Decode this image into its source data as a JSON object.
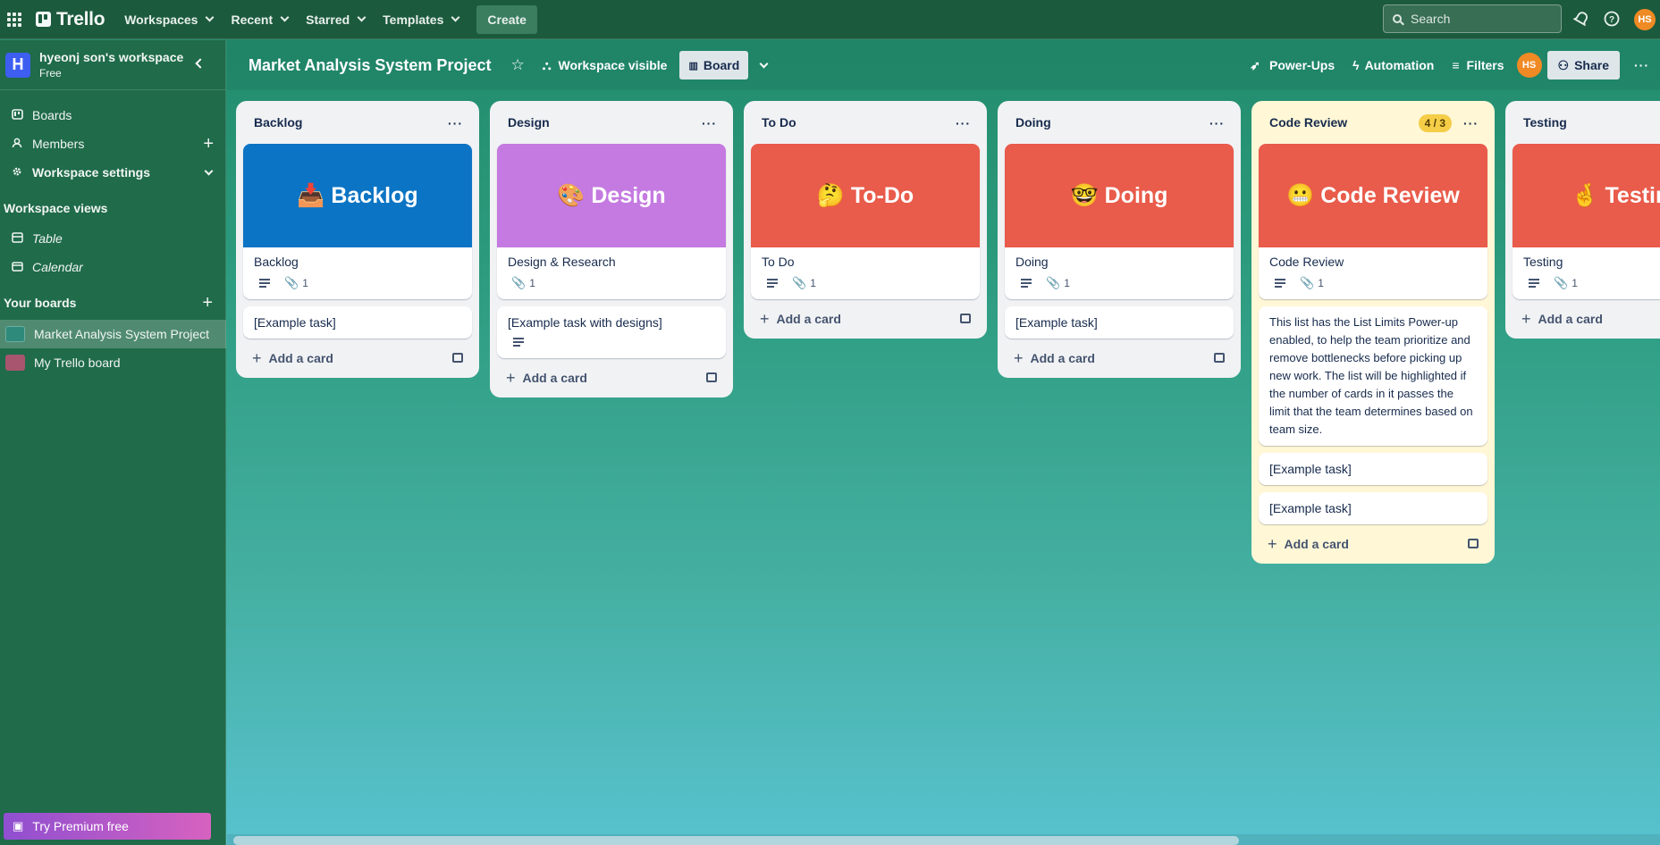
{
  "topbar": {
    "logo": "Trello",
    "nav": [
      "Workspaces",
      "Recent",
      "Starred",
      "Templates"
    ],
    "create": "Create",
    "search_placeholder": "Search",
    "avatar": "HS"
  },
  "sidebar": {
    "workspace_name": "hyeonj son's workspace",
    "workspace_initial": "H",
    "plan": "Free",
    "items": [
      {
        "label": "Boards",
        "icon": "board-icon"
      },
      {
        "label": "Members",
        "icon": "person-icon"
      },
      {
        "label": "Workspace settings",
        "icon": "gear-icon"
      }
    ],
    "views_title": "Workspace views",
    "views": [
      {
        "label": "Table",
        "icon": "table-icon"
      },
      {
        "label": "Calendar",
        "icon": "calendar-icon"
      }
    ],
    "your_boards_title": "Your boards",
    "boards": [
      {
        "label": "Market Analysis System Project",
        "color": "#2e8a7a"
      },
      {
        "label": "My Trello board",
        "color": "#a8556f"
      }
    ],
    "premium": "Try Premium free"
  },
  "board": {
    "title": "Market Analysis System Project",
    "visibility": "Workspace visible",
    "view": "Board",
    "powerups": "Power-Ups",
    "automation": "Automation",
    "filters": "Filters",
    "share": "Share",
    "avatar": "HS"
  },
  "lists": [
    {
      "title": "Backlog",
      "cover_text": "📥 Backlog",
      "cover_color": "#0c74c4",
      "cover_card_title": "Backlog",
      "has_desc": true,
      "attachments": "1",
      "cards": [
        "[Example task]"
      ],
      "add": "Add a card"
    },
    {
      "title": "Design",
      "cover_text": "🎨 Design",
      "cover_color": "#c47ae0",
      "cover_card_title": "Design & Research",
      "has_desc": false,
      "attachments": "1",
      "cards": [
        "[Example task with designs]"
      ],
      "add": "Add a card"
    },
    {
      "title": "To Do",
      "cover_text": "🤔 To-Do",
      "cover_color": "#e95b4a",
      "cover_card_title": "To Do",
      "has_desc": true,
      "attachments": "1",
      "cards": [],
      "add": "Add a card"
    },
    {
      "title": "Doing",
      "cover_text": "🤓 Doing",
      "cover_color": "#e95b4a",
      "cover_card_title": "Doing",
      "has_desc": true,
      "attachments": "1",
      "cards": [
        "[Example task]"
      ],
      "add": "Add a card"
    },
    {
      "title": "Code Review",
      "limit": "4 / 3",
      "cover_text": "😬 Code Review",
      "cover_color": "#e95b4a",
      "cover_card_title": "Code Review",
      "has_desc": true,
      "attachments": "1",
      "cards": [
        "This list has the List Limits Power-up enabled, to help the team prioritize and remove bottlenecks before picking up new work. The list will be highlighted if the number of cards in it passes the limit that the team determines based on team size.",
        "[Example task]",
        "[Example task]"
      ],
      "add": "Add a card"
    },
    {
      "title": "Testing",
      "cover_text": "🤞 Testing",
      "cover_color": "#e95b4a",
      "cover_card_title": "Testing",
      "has_desc": true,
      "attachments": "1",
      "cards": [],
      "add": "Add a card"
    }
  ]
}
